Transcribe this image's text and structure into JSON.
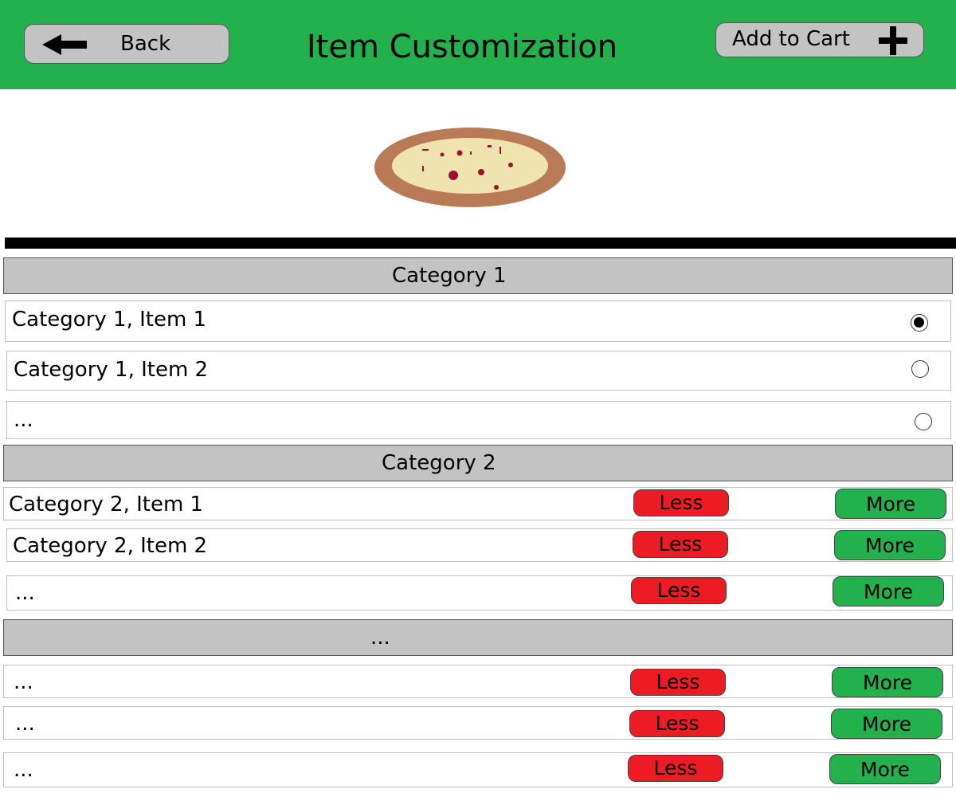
{
  "header": {
    "title": "Item Customization",
    "back_label": "Back",
    "add_to_cart_label": "Add to Cart"
  },
  "colors": {
    "header_bg": "#22b14c",
    "category_bg": "#c3c3c3",
    "less_button": "#ed1c24",
    "more_button": "#22b14c",
    "pizza_crust": "#b97a57",
    "pizza_cheese": "#efe4b0",
    "pizza_topping": "#a0102a"
  },
  "icons": {
    "back": "left-arrow-icon",
    "add": "plus-icon",
    "product": "pizza-icon"
  },
  "category1": {
    "title": "Category 1",
    "items": [
      {
        "label": "Category 1, Item 1",
        "selected": true
      },
      {
        "label": "Category 1, Item 2",
        "selected": false
      },
      {
        "label": "...",
        "selected": false
      }
    ]
  },
  "category2": {
    "title": "Category 2",
    "items": [
      {
        "label": "Category 2, Item 1"
      },
      {
        "label": "Category 2, Item 2"
      },
      {
        "label": "..."
      }
    ]
  },
  "category3": {
    "title": "...",
    "items": [
      {
        "label": "..."
      },
      {
        "label": "..."
      },
      {
        "label": "..."
      }
    ]
  },
  "buttons": {
    "less_label": "Less",
    "more_label": "More"
  }
}
